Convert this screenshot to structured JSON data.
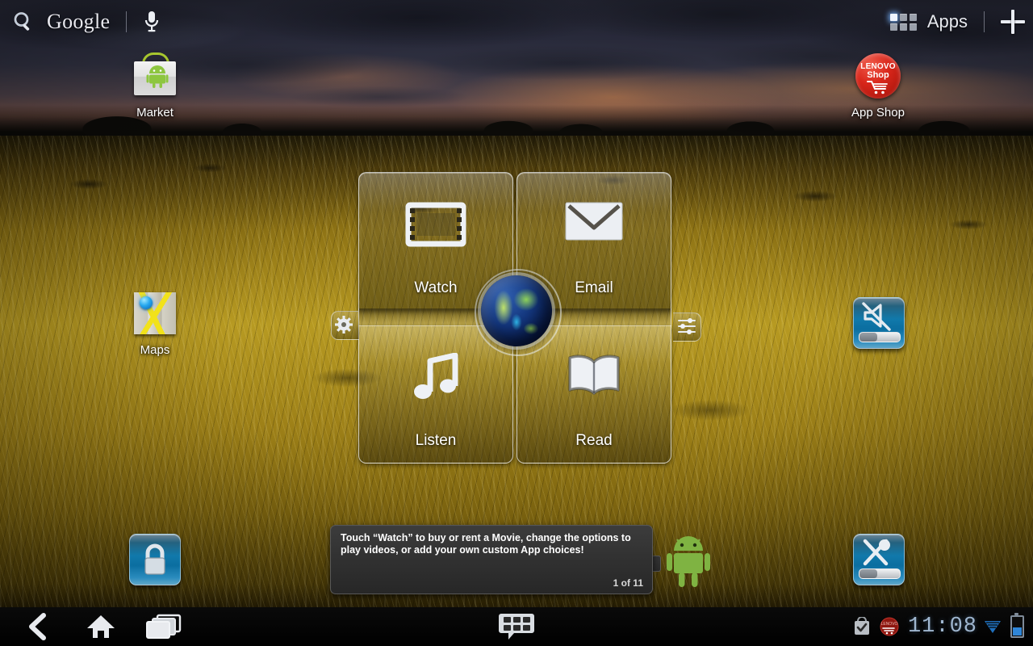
{
  "topbar": {
    "search_icon": "search-icon",
    "google_label": "Google",
    "mic_icon": "microphone-icon",
    "apps_label": "Apps",
    "apps_icon": "apps-grid-icon",
    "add_icon": "plus-icon"
  },
  "home_icons": [
    {
      "id": "market",
      "label": "Market",
      "icon": "market-bag-icon"
    },
    {
      "id": "app_shop",
      "label": "App Shop",
      "icon": "lenovo-shop-icon",
      "brand_top": "LENOVO",
      "brand_bottom": "Shop",
      "color": "#d8261a"
    },
    {
      "id": "maps",
      "label": "Maps",
      "icon": "maps-icon"
    }
  ],
  "widgets": {
    "lock": {
      "name": "screen-lock-widget",
      "icon": "padlock-icon"
    },
    "mute": {
      "name": "mute-volume-widget",
      "icon": "speaker-muted-icon"
    },
    "brightness": {
      "name": "brightness-widget",
      "icon": "brightness-icon"
    }
  },
  "center_widget": {
    "name": "media-hub-widget",
    "quadrants": [
      {
        "id": "watch",
        "label": "Watch",
        "icon": "film-strip-icon"
      },
      {
        "id": "email",
        "label": "Email",
        "icon": "envelope-icon"
      },
      {
        "id": "listen",
        "label": "Listen",
        "icon": "music-note-icon"
      },
      {
        "id": "read",
        "label": "Read",
        "icon": "open-book-icon"
      }
    ],
    "center_icon": "globe-icon",
    "left_handle_icon": "gear-icon",
    "right_handle_icon": "sliders-icon"
  },
  "tooltip": {
    "text": "Touch “Watch” to buy or rent a Movie, change the options to play videos, or add your own custom App choices!",
    "counter": "1 of 11"
  },
  "mascot": {
    "name": "android-robot",
    "color": "#8dc63f"
  },
  "system_bar": {
    "back_icon": "back-chevron-icon",
    "home_icon": "home-icon",
    "recent_icon": "recent-apps-icon",
    "ime_icon": "keyboard-switcher-icon",
    "status": {
      "market_notification_icon": "market-download-complete-icon",
      "shop_notification_icon": "lenovo-shop-notification-icon",
      "clock": "11:08",
      "wifi_icon": "wifi-signal-icon",
      "battery_icon": "battery-icon"
    }
  }
}
